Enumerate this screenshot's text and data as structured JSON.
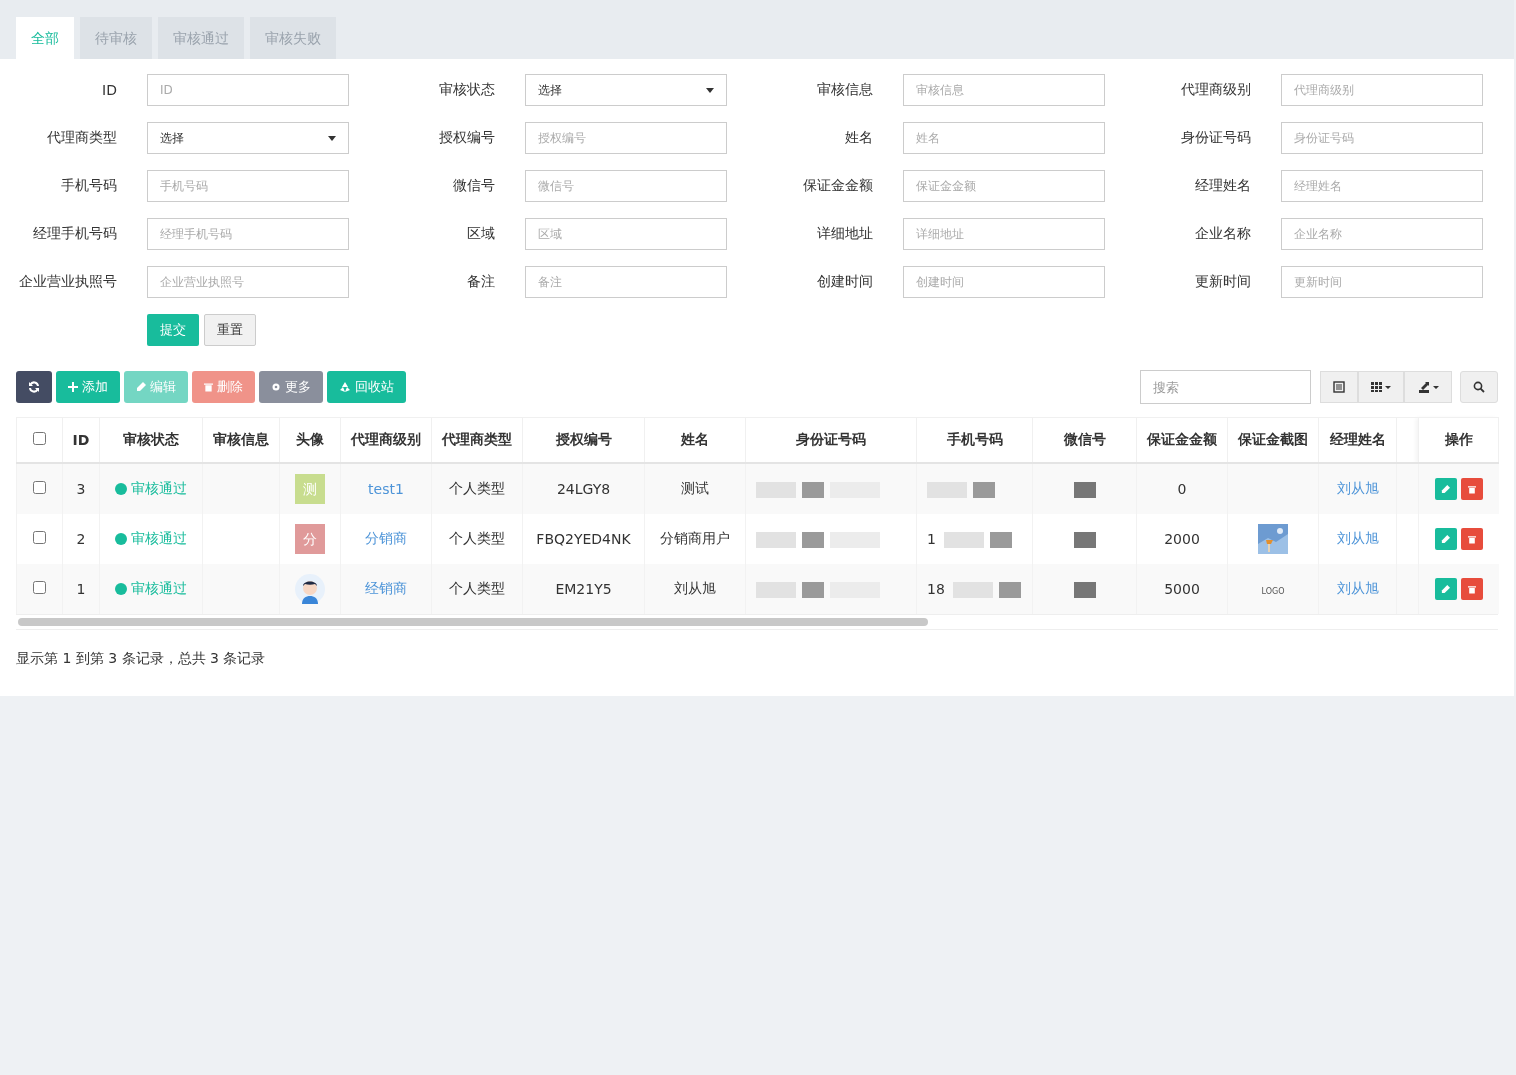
{
  "tabs": [
    {
      "label": "全部",
      "selected": true
    },
    {
      "label": "待审核",
      "selected": false
    },
    {
      "label": "审核通过",
      "selected": false
    },
    {
      "label": "审核失败",
      "selected": false
    }
  ],
  "filters": [
    {
      "label": "ID",
      "kind": "input",
      "placeholder": "ID"
    },
    {
      "label": "审核状态",
      "kind": "select",
      "value": "选择"
    },
    {
      "label": "审核信息",
      "kind": "input",
      "placeholder": "审核信息"
    },
    {
      "label": "代理商级别",
      "kind": "input",
      "placeholder": "代理商级别"
    },
    {
      "label": "代理商类型",
      "kind": "select",
      "value": "选择"
    },
    {
      "label": "授权编号",
      "kind": "input",
      "placeholder": "授权编号"
    },
    {
      "label": "姓名",
      "kind": "input",
      "placeholder": "姓名"
    },
    {
      "label": "身份证号码",
      "kind": "input",
      "placeholder": "身份证号码"
    },
    {
      "label": "手机号码",
      "kind": "input",
      "placeholder": "手机号码"
    },
    {
      "label": "微信号",
      "kind": "input",
      "placeholder": "微信号"
    },
    {
      "label": "保证金金额",
      "kind": "input",
      "placeholder": "保证金金额"
    },
    {
      "label": "经理姓名",
      "kind": "input",
      "placeholder": "经理姓名"
    },
    {
      "label": "经理手机号码",
      "kind": "input",
      "placeholder": "经理手机号码"
    },
    {
      "label": "区域",
      "kind": "input",
      "placeholder": "区域"
    },
    {
      "label": "详细地址",
      "kind": "input",
      "placeholder": "详细地址"
    },
    {
      "label": "企业名称",
      "kind": "input",
      "placeholder": "企业名称"
    },
    {
      "label": "企业营业执照号",
      "kind": "input",
      "placeholder": "企业营业执照号"
    },
    {
      "label": "备注",
      "kind": "input",
      "placeholder": "备注"
    },
    {
      "label": "创建时间",
      "kind": "input",
      "placeholder": "创建时间"
    },
    {
      "label": "更新时间",
      "kind": "input",
      "placeholder": "更新时间"
    }
  ],
  "form_buttons": [
    "提交",
    "重置"
  ],
  "toolbar": [
    {
      "kind": "refresh",
      "disabled": false
    },
    {
      "kind": "add",
      "label": "添加",
      "disabled": false
    },
    {
      "kind": "edit",
      "label": "编辑",
      "disabled": true
    },
    {
      "kind": "delete",
      "label": "删除",
      "disabled": true
    },
    {
      "kind": "more",
      "label": "更多",
      "disabled": false
    },
    {
      "kind": "recycle",
      "label": "回收站",
      "disabled": false
    }
  ],
  "search": {
    "placeholder": "搜索"
  },
  "select_all_checked": false,
  "columns": [
    "ID",
    "审核状态",
    "审核信息",
    "头像",
    "代理商级别",
    "代理商类型",
    "授权编号",
    "姓名",
    "身份证号码",
    "手机号码",
    "微信号",
    "保证金金额",
    "保证金截图",
    "经理姓名",
    "操作"
  ],
  "rows": [
    {
      "checked": false,
      "id": "3",
      "status": "审核通过",
      "avatar": {
        "kind": "letter",
        "text": "测",
        "color": "#c8dd8f"
      },
      "level": "test1",
      "type": "个人类型",
      "auth_no": "24LGY8",
      "name": "测试",
      "id_card": "",
      "phone": "",
      "wechat": "",
      "deposit": "0",
      "screenshot": {
        "kind": "none"
      },
      "manager": "刘从旭"
    },
    {
      "checked": false,
      "id": "2",
      "status": "审核通过",
      "avatar": {
        "kind": "letter",
        "text": "分",
        "color": "#e09a9a"
      },
      "level": "分销商",
      "type": "个人类型",
      "auth_no": "FBQ2YED4NK",
      "name": "分销商用户",
      "id_card": "",
      "phone": "1",
      "wechat": "",
      "deposit": "2000",
      "manager": "刘从旭"
    },
    {
      "checked": false,
      "id": "1",
      "status": "审核通过",
      "avatar": {
        "kind": "figure"
      },
      "level": "经销商",
      "type": "个人类型",
      "auth_no": "EM21Y5",
      "name": "刘从旭",
      "id_card": "",
      "phone": "18",
      "wechat": "",
      "deposit": "5000",
      "screenshot": {
        "kind": "logo",
        "text": "LOGO"
      },
      "manager": "刘从旭"
    }
  ],
  "summary": "显示第 1 到第 3 条记录，总共 3 条记录"
}
